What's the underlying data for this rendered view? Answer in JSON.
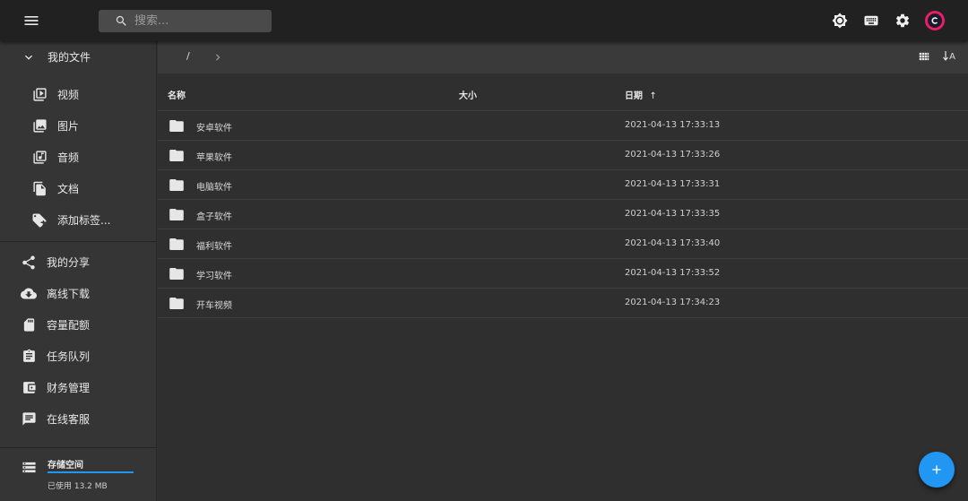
{
  "search": {
    "placeholder": "搜索..."
  },
  "header": {
    "icons": [
      "brightness-icon",
      "keyboard-icon",
      "gear-icon",
      "avatar"
    ],
    "accent_color": "#e91e63"
  },
  "sidebar": {
    "my_files_label": "我的文件",
    "file_types": [
      {
        "label": "视频",
        "icon": "video-icon"
      },
      {
        "label": "图片",
        "icon": "image-icon"
      },
      {
        "label": "音频",
        "icon": "audio-icon"
      },
      {
        "label": "文档",
        "icon": "document-icon"
      },
      {
        "label": "添加标签...",
        "icon": "add-tag-icon"
      }
    ],
    "nav": [
      {
        "label": "我的分享",
        "icon": "share-icon"
      },
      {
        "label": "离线下载",
        "icon": "cloud-download-icon"
      },
      {
        "label": "容量配额",
        "icon": "sd-card-icon"
      },
      {
        "label": "任务队列",
        "icon": "clipboard-icon"
      },
      {
        "label": "财务管理",
        "icon": "wallet-icon"
      },
      {
        "label": "在线客服",
        "icon": "chat-icon"
      }
    ],
    "storage": {
      "title": "存储空间",
      "used": "已使用 13.2 MB",
      "fill_ratio": 1.0,
      "bar_color": "#2196f3"
    }
  },
  "toolbar": {
    "path_root": "/",
    "sort_label": "A"
  },
  "table": {
    "headers": {
      "name": "名称",
      "size": "大小",
      "date": "日期",
      "sort_indicator": "↑"
    },
    "rows": [
      {
        "name": "安卓软件",
        "size": "",
        "date": "2021-04-13 17:33:13"
      },
      {
        "name": "苹果软件",
        "size": "",
        "date": "2021-04-13 17:33:26"
      },
      {
        "name": "电脑软件",
        "size": "",
        "date": "2021-04-13 17:33:31"
      },
      {
        "name": "盒子软件",
        "size": "",
        "date": "2021-04-13 17:33:35"
      },
      {
        "name": "福利软件",
        "size": "",
        "date": "2021-04-13 17:33:40"
      },
      {
        "name": "学习软件",
        "size": "",
        "date": "2021-04-13 17:33:52"
      },
      {
        "name": "开车视频",
        "size": "",
        "date": "2021-04-13 17:34:23"
      }
    ]
  },
  "fab": {
    "label": "+",
    "color": "#2196f3"
  }
}
